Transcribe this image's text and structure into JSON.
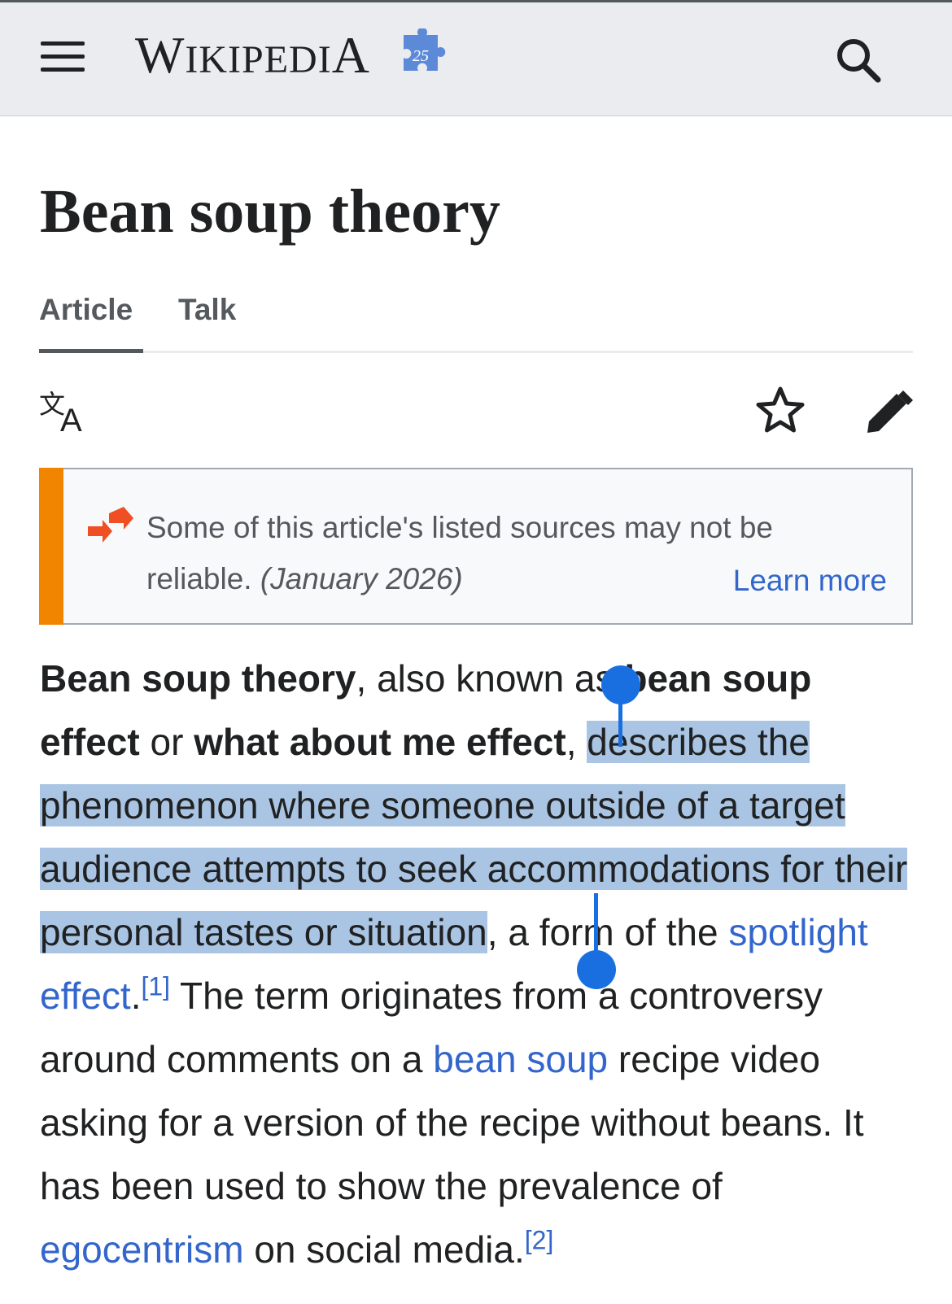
{
  "header": {
    "wordmark": "Wikipedia",
    "wordmark_first": "W",
    "wordmark_rest": "IKIPEDI",
    "wordmark_last": "A",
    "anniversary_badge": "25",
    "icons": {
      "menu": "hamburger-menu-icon",
      "search": "search-icon",
      "badge": "puzzle-piece-icon"
    }
  },
  "page": {
    "title": "Bean soup theory"
  },
  "tabs": [
    {
      "label": "Article",
      "active": true
    },
    {
      "label": "Talk",
      "active": false
    }
  ],
  "toolbar": {
    "icons": [
      "language-icon",
      "star-watch-icon",
      "pencil-edit-icon"
    ]
  },
  "notice": {
    "text": "Some of this article's listed sources may not be reliable.",
    "date": "(January 2026)",
    "link": "Learn more",
    "accent_color": "#f28500",
    "icon": "merge-arrows-icon"
  },
  "article": {
    "p1_bold1": "Bean soup theory",
    "p1_t1": ", also known as ",
    "p1_bold2": "bean soup effect",
    "p1_t2": " or ",
    "p1_bold3": "what about me effect",
    "p1_t3": ", ",
    "p1_selected": "describes the phenomenon where someone outside of a target audience attempts to seek accommodations for their personal tastes or situation",
    "p1_t4": ", a form of the ",
    "link1": "spotlight effect",
    "p1_t5": ".",
    "ref1": "[1]",
    "p1_t6": " The term originates from a controversy around comments on a ",
    "link2": "bean soup",
    "p1_t7": " recipe video asking for a version of the recipe without beans. It has been used to show the prevalence of ",
    "link3": "egocentrism",
    "p1_t8": " on social media.",
    "ref2": "[2]"
  },
  "colors": {
    "link": "#3366cc",
    "selection": "#a9c5e3",
    "selection_handle": "#1a6fe0"
  }
}
